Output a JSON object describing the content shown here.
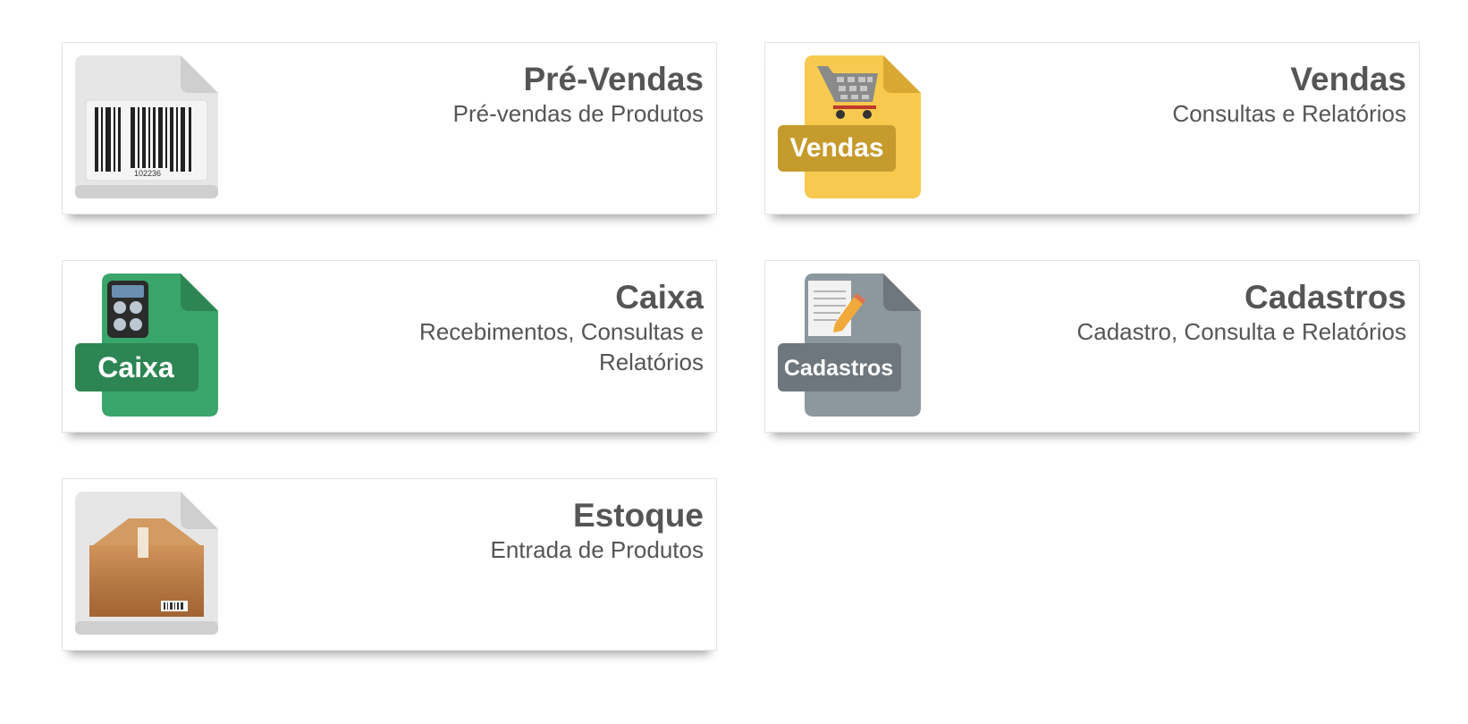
{
  "cards": [
    {
      "title": "Pré-Vendas",
      "subtitle": "Pré-vendas de Produtos",
      "icon": "barcode-file-icon"
    },
    {
      "title": "Vendas",
      "subtitle": "Consultas e Relatórios",
      "icon": "shopping-cart-file-icon",
      "badge": "Vendas",
      "color": "#f7c94f"
    },
    {
      "title": "Caixa",
      "subtitle": "Recebimentos, Consultas e Relatórios",
      "icon": "calculator-file-icon",
      "badge": "Caixa",
      "color": "#3aa56a"
    },
    {
      "title": "Cadastros",
      "subtitle": "Cadastro, Consulta e Relatórios",
      "icon": "document-pencil-file-icon",
      "badge": "Cadastros",
      "color": "#8c979e"
    },
    {
      "title": "Estoque",
      "subtitle": "Entrada de Produtos",
      "icon": "cardboard-box-file-icon"
    }
  ],
  "barcode_number": "102236"
}
